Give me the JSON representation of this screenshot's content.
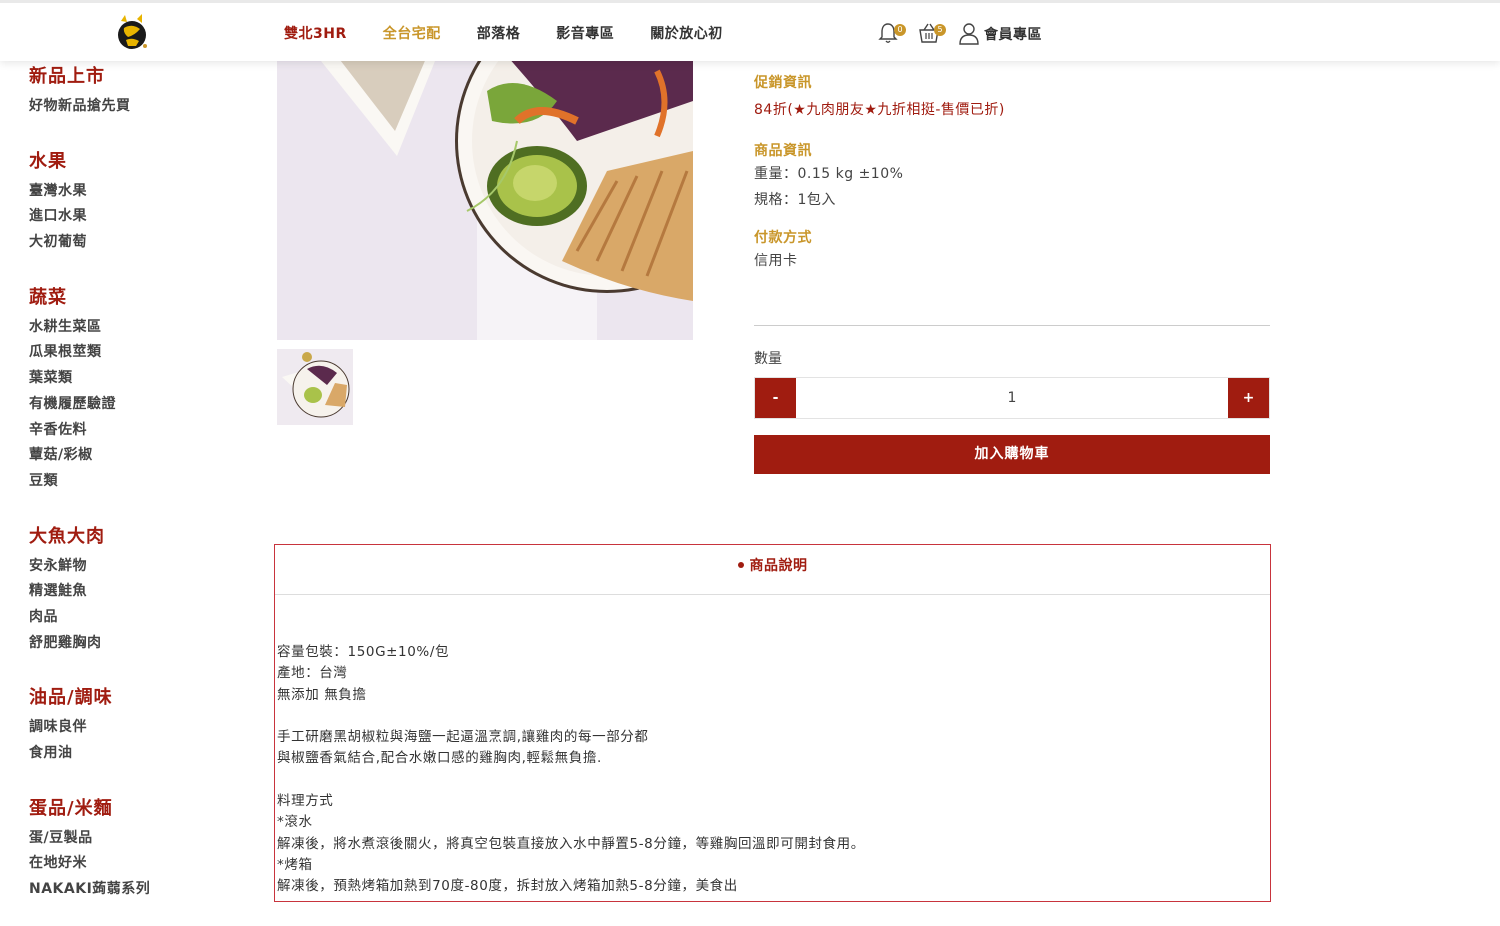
{
  "header": {
    "logo_alt": "放心初",
    "nav": [
      {
        "label": "雙北3HR",
        "style": "red"
      },
      {
        "label": "全台宅配",
        "style": "gold"
      },
      {
        "label": "部落格",
        "style": ""
      },
      {
        "label": "影音專區",
        "style": ""
      },
      {
        "label": "關於放心初",
        "style": ""
      }
    ],
    "notification_count": "0",
    "cart_count": "5",
    "member_label": "會員專區"
  },
  "sidebar": {
    "groups": [
      {
        "title": "新品上市",
        "items": [
          "好物新品搶先買"
        ]
      },
      {
        "title": "水果",
        "items": [
          "臺灣水果",
          "進口水果",
          "大初葡萄"
        ]
      },
      {
        "title": "蔬菜",
        "items": [
          "水耕生菜區",
          "瓜果根莖類",
          "葉菜類",
          "有機履歷驗證",
          "辛香佐料",
          "蕈菇/彩椒",
          "豆類"
        ]
      },
      {
        "title": "大魚大肉",
        "items": [
          "安永鮮物",
          "精選鮭魚",
          "肉品",
          "舒肥雞胸肉"
        ]
      },
      {
        "title": "油品/調味",
        "items": [
          "調味良伴",
          "食用油"
        ]
      },
      {
        "title": "蛋品/米麵",
        "items": [
          "蛋/豆製品",
          "在地好米",
          "NAKAKI蒟蒻系列"
        ]
      }
    ]
  },
  "product": {
    "promo_label": "促銷資訊",
    "promo_text": "84折(★九肉朋友★九折相挺-售價已折)",
    "info_label": "商品資訊",
    "weight": "重量：0.15 kg ±10%",
    "spec": "規格：1包入",
    "payment_label": "付款方式",
    "payment": "信用卡",
    "qty_label": "數量",
    "qty_minus": "-",
    "qty_value": "1",
    "qty_plus": "+",
    "add_to_cart": "加入購物車"
  },
  "description": {
    "tab": "商品說明",
    "lines": [
      "容量包裝：150G±10%/包",
      "產地：台灣",
      "無添加 無負擔",
      "",
      "手工研磨黑胡椒粒與海鹽一起逼溫烹調,讓雞肉的每一部分都",
      "與椒鹽香氣結合,配合水嫩口感的雞胸肉,輕鬆無負擔.",
      "",
      "料理方式",
      "*滾水",
      "解凍後，將水煮滾後關火，將真空包裝直接放入水中靜置5-8分鐘，等雞胸回溫即可開封食用。",
      "*烤箱",
      "解凍後，預熱烤箱加熱到70度-80度，拆封放入烤箱加熱5-8分鐘，美食出"
    ]
  },
  "colors": {
    "brand_red": "#a01c10",
    "gold": "#c9962a"
  }
}
